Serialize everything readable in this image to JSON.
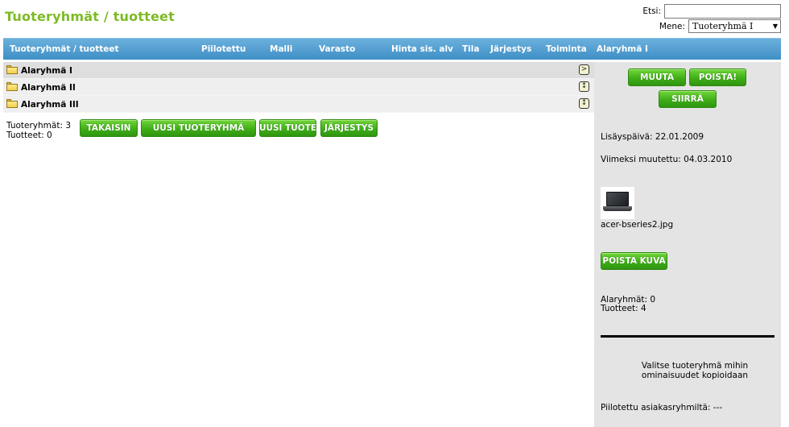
{
  "page": {
    "title": "Tuoteryhmät / tuotteet"
  },
  "search": {
    "label": "Etsi:",
    "value": ""
  },
  "goto": {
    "label": "Mene:",
    "selected": "Tuoteryhmä I"
  },
  "columns": [
    "Tuoteryhmät / tuotteet",
    "Piilotettu",
    "Malli",
    "Varasto",
    "Hinta sis. alv",
    "Tila",
    "Järjestys",
    "Toiminta",
    "Alaryhmä I"
  ],
  "groups": [
    {
      "label": "Alaryhmä I",
      "action_icon": "arrow-right-icon",
      "action_glyph": ">"
    },
    {
      "label": "Alaryhmä II",
      "action_icon": "sort-icon",
      "action_glyph": "↕"
    },
    {
      "label": "Alaryhmä III",
      "action_icon": "sort-icon",
      "action_glyph": "↕"
    }
  ],
  "counts": {
    "groups": "Tuoteryhmät: 3",
    "products": "Tuotteet: 0"
  },
  "buttons": {
    "back": "TAKAISIN",
    "new_group": "UUSI TUOTERYHMÄ",
    "new_product": "UUSI TUOTE",
    "order": "JÄRJESTYS"
  },
  "side": {
    "edit": "MUUTA",
    "delete": "POISTA!",
    "move": "SIIRRÄ",
    "added": "Lisäyspäivä: 22.01.2009",
    "modified": "Viimeksi muutettu: 04.03.2010",
    "image_name": "acer-bseries2.jpg",
    "delete_image": "POISTA KUVA",
    "subgroups": "Alaryhmät: 0",
    "products": "Tuotteet: 4",
    "copy_note": "Valitse tuoteryhmä mihin ominaisuudet kopioidaan",
    "hidden_from": "Piilotettu asiakasryhmiltä: ---"
  },
  "colors": {
    "title_green": "#7dbb23",
    "header_blue": "#4a98cd",
    "button_green": "#3fae17"
  }
}
